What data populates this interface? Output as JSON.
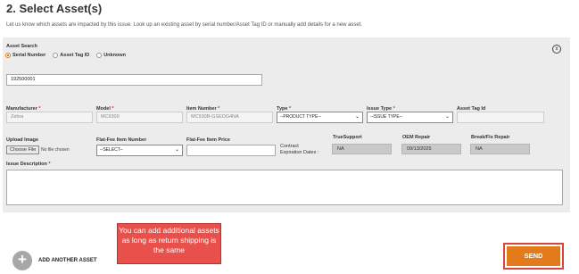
{
  "page": {
    "title": "2. Select Asset(s)",
    "intro": "Let us know which assets are impacted by this issue. Look up an existing asset by serial number/Asset Tag ID or manually add details for a new asset."
  },
  "asset": {
    "search_label": "Asset Search",
    "radios": [
      "Serial Number",
      "Asset Tag ID",
      "Unknown"
    ],
    "selected_radio": "Serial Number",
    "close_glyph": "x",
    "serial_value": "192500001",
    "required_mark": "*",
    "labels": {
      "manufacturer": "Manufacturer",
      "model": "Model",
      "item_number": "Item Number",
      "type": "Type",
      "issue_type": "Issue Type",
      "asset_tag_id": "Asset Tag Id",
      "upload_image": "Upload Image",
      "flat_fee_item_number": "Flat-Fee Item Number",
      "flat_fee_item_price": "Flat-Fee Item Price",
      "contract_expiration_1": "Contract",
      "contract_expiration_2": "Expiration Dates :",
      "truesupport": "TrueSupport",
      "oem_repair": "OEM Repair",
      "break_fix_repair": "Break/Fix Repair",
      "issue_description": "Issue Description"
    },
    "values": {
      "manufacturer": "Zebra",
      "model": "MC9300",
      "item_number": "MC930B-GSEDG4NA",
      "type": "--PRODUCT TYPE--",
      "issue_type": "--ISSUE TYPE--",
      "asset_tag_id": "",
      "flat_fee_item_number": "--SELECT--",
      "flat_fee_item_price": "",
      "truesupport": "NA",
      "oem_repair": "09/13/2025",
      "break_fix_repair": "NA"
    },
    "file_button": "Choose File",
    "file_none": "No file chosen"
  },
  "actions": {
    "add_another": "ADD ANOTHER ASSET",
    "add_glyph": "+",
    "send": "SEND"
  },
  "callout": {
    "text": "You can add additional assets as long as return shipping is the same"
  },
  "colors": {
    "accent_orange": "#e37b1b",
    "callout_red": "#e9504b",
    "panel_gray": "#ececec"
  }
}
